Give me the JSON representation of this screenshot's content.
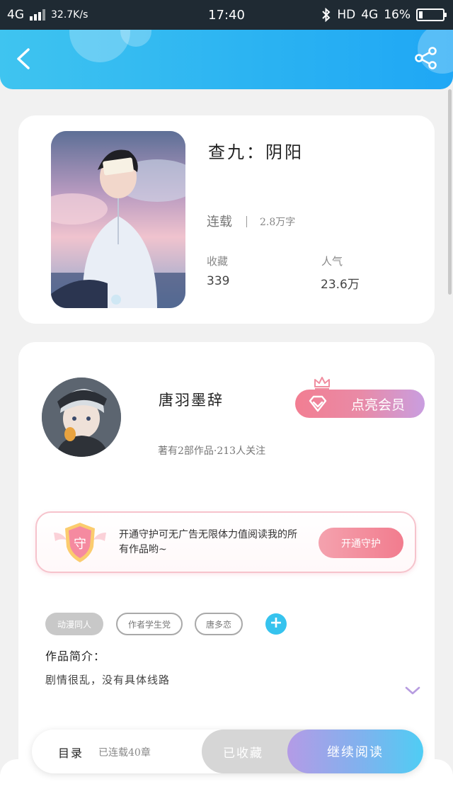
{
  "status_bar": {
    "network": "4G",
    "speed": "32.7K/s",
    "time": "17:40",
    "hd": "HD",
    "network_right": "4G",
    "battery": "16%",
    "battery_level": 0.16
  },
  "header": {
    "back_icon": "chevron-left-icon",
    "share_icon": "share-icon"
  },
  "book": {
    "title": "查九：阴阳",
    "status": "连载",
    "words": "2.8万字",
    "favorites_label": "收藏",
    "favorites_value": "339",
    "popularity_label": "人气",
    "popularity_value": "23.6万"
  },
  "author": {
    "name": "唐羽墨辞",
    "works_info": "著有2部作品·213人关注",
    "vip_button": "点亮会员"
  },
  "guard": {
    "badge_char": "守",
    "text": "开通守护可无广告无限体力值阅读我的所有作品哟~",
    "button": "开通守护"
  },
  "tags": [
    "动漫同人",
    "作者学生党",
    "唐多恋"
  ],
  "intro": {
    "label": "作品简介：",
    "text": "剧情很乱，没有具体线路"
  },
  "bottom_bar": {
    "toc_label": "目录",
    "chapter_count": "已连载40章",
    "collected": "已收藏",
    "continue_reading": "继续阅读"
  },
  "colors": {
    "header": "#2ab2f2",
    "accent_pink": "#f27c8e",
    "accent_blue": "#36c3ee"
  }
}
